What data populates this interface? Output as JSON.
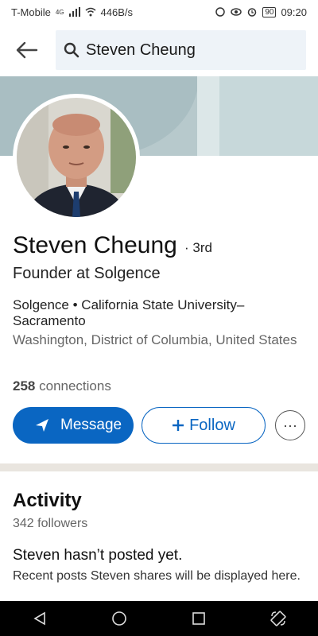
{
  "status_bar": {
    "carrier": "T-Mobile",
    "network": "4G",
    "speed": "446B/s",
    "battery": "90",
    "time": "09:20"
  },
  "search": {
    "value": "Steven Cheung"
  },
  "profile": {
    "name": "Steven Cheung",
    "degree": "· 3rd",
    "headline": "Founder at Solgence",
    "orgs": "Solgence  •  California State University–Sacramento",
    "location": "Washington, District of Columbia, United States",
    "connections_count": "258",
    "connections_label": "connections"
  },
  "actions": {
    "message_label": "Message",
    "follow_label": "Follow",
    "more_label": "···"
  },
  "activity": {
    "title": "Activity",
    "followers": "342 followers",
    "empty_title": "Steven hasn’t posted yet.",
    "empty_sub": "Recent posts Steven shares will be displayed here."
  },
  "colors": {
    "accent": "#0a66c2",
    "cover": "#b7c9cc"
  }
}
